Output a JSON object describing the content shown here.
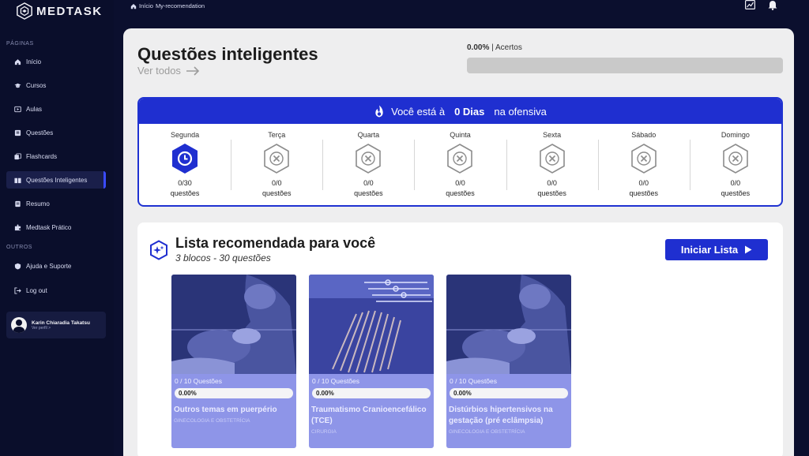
{
  "brand": {
    "name": "MEDTASK"
  },
  "sidebar": {
    "section_pages": "PÁGINAS",
    "section_other": "OUTROS",
    "items": [
      {
        "label": "Início",
        "icon": "home-icon"
      },
      {
        "label": "Cursos",
        "icon": "graduation-cap-icon"
      },
      {
        "label": "Aulas",
        "icon": "play-icon"
      },
      {
        "label": "Questões",
        "icon": "book-icon"
      },
      {
        "label": "Flashcards",
        "icon": "cards-icon"
      },
      {
        "label": "Questões Inteligentes",
        "icon": "smart-book-icon",
        "active": true
      },
      {
        "label": "Resumo",
        "icon": "document-icon"
      },
      {
        "label": "Medtask Prático",
        "icon": "puzzle-icon"
      }
    ],
    "other_items": [
      {
        "label": "Ajuda e Suporte",
        "icon": "help-icon"
      },
      {
        "label": "Log out",
        "icon": "logout-icon"
      }
    ],
    "profile": {
      "name": "Karin Chiaradia Takatsu",
      "link": "Ver perfil >"
    }
  },
  "topbar": {
    "breadcrumb_home": "Início",
    "breadcrumb_current": "My-recomendation"
  },
  "main": {
    "title": "Questões inteligentes",
    "see_all": "Ver todos",
    "accuracy_value": "0.00%",
    "accuracy_label": "| Acertos",
    "accuracy_fraction": 0
  },
  "streak": {
    "prefix": "Você está à",
    "days": "0 Dias",
    "suffix": "na ofensiva",
    "week": [
      {
        "name": "Segunda",
        "count": "0/30",
        "unit": "questões",
        "state": "current"
      },
      {
        "name": "Terça",
        "count": "0/0",
        "unit": "questões",
        "state": "empty"
      },
      {
        "name": "Quarta",
        "count": "0/0",
        "unit": "questões",
        "state": "empty"
      },
      {
        "name": "Quinta",
        "count": "0/0",
        "unit": "questões",
        "state": "empty"
      },
      {
        "name": "Sexta",
        "count": "0/0",
        "unit": "questões",
        "state": "empty"
      },
      {
        "name": "Sábado",
        "count": "0/0",
        "unit": "questões",
        "state": "empty"
      },
      {
        "name": "Domingo",
        "count": "0/0",
        "unit": "questões",
        "state": "empty"
      }
    ]
  },
  "recommended": {
    "title": "Lista recomendada para você",
    "subtitle": "3 blocos - 30 questões",
    "start_label": "Iniciar Lista",
    "cards": [
      {
        "progress": "0 / 10 Questões",
        "pct": "0.00%",
        "title": "Outros temas em puerpério",
        "category": "GINECOLOGIA E OBSTETRÍCIA",
        "image": "surgery-photo"
      },
      {
        "progress": "0 / 10 Questões",
        "pct": "0.00%",
        "title": "Traumatismo Cranioencefálico (TCE)",
        "category": "CIRURGIA",
        "image": "surgical-instruments-photo"
      },
      {
        "progress": "0 / 10 Questões",
        "pct": "0.00%",
        "title": "Distúrbios hipertensivos na gestação (pré eclâmpsia)",
        "category": "GINECOLOGIA E OBSTETRÍCIA",
        "image": "surgery-photo"
      }
    ]
  },
  "colors": {
    "accent": "#1f2fd0",
    "sidebar_bg": "#0a0e2b",
    "card_bg": "#8e95e8"
  }
}
